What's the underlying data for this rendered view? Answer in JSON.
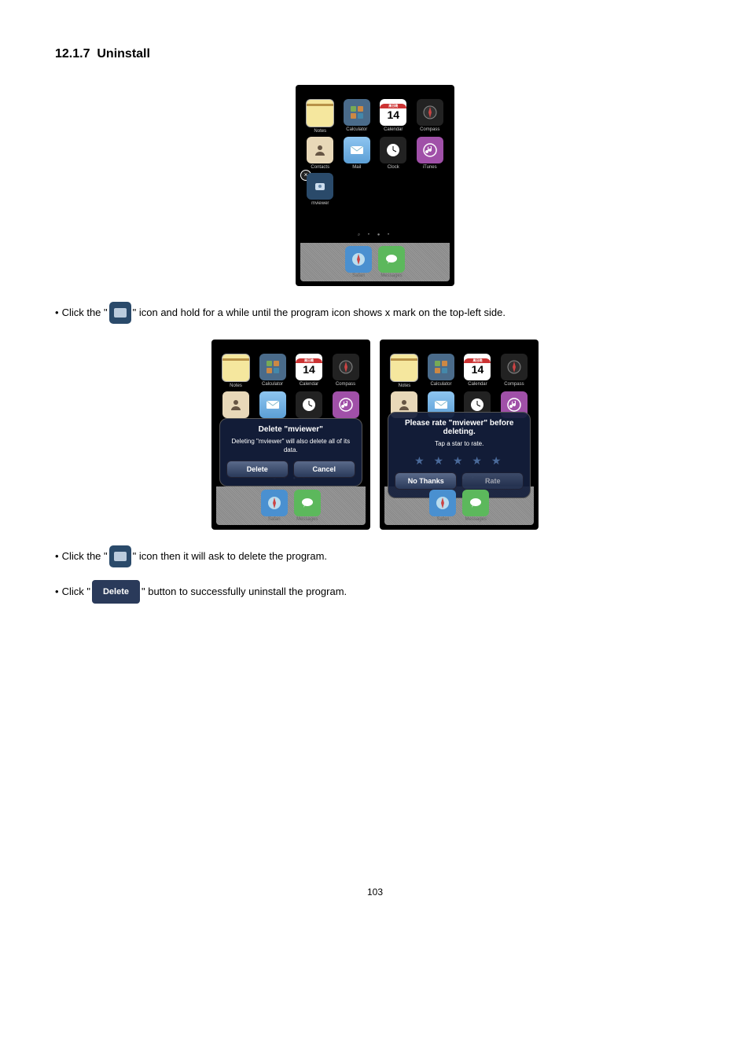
{
  "section": {
    "number": "12.1.7",
    "title": "Uninstall"
  },
  "apps": {
    "notes": "Notes",
    "calculator": "Calculator",
    "calendar": "Calendar",
    "calendar_top": "周日晚",
    "calendar_day": "14",
    "compass": "Compass",
    "contacts": "Contacts",
    "mail": "Mail",
    "clock": "Clock",
    "itunes": "iTunes",
    "mviewer": "mviewer",
    "safari": "Safari",
    "messages": "Messages"
  },
  "delete_modal": {
    "title": "Delete \"mviewer\"",
    "subtitle": "Deleting \"mviewer\" will also delete all of its data.",
    "delete": "Delete",
    "cancel": "Cancel"
  },
  "rate_modal": {
    "title": "Please rate \"mviewer\" before deleting.",
    "subtitle": "Tap a star to rate.",
    "no_thanks": "No Thanks",
    "rate": "Rate"
  },
  "body_text": {
    "bullet1_pre": "Click the  \"",
    "bullet1_post": "\"  icon and hold for a while until the program icon shows x mark on the top-left side.",
    "bullet2_pre": "Click the  \"",
    "bullet2_post": "\"  icon then it will ask to delete the program.",
    "bullet3_pre": "Click  \"",
    "bullet3_post": "\"  button to successfully uninstall the program.",
    "delete_label": "Delete"
  },
  "page_number": "103"
}
